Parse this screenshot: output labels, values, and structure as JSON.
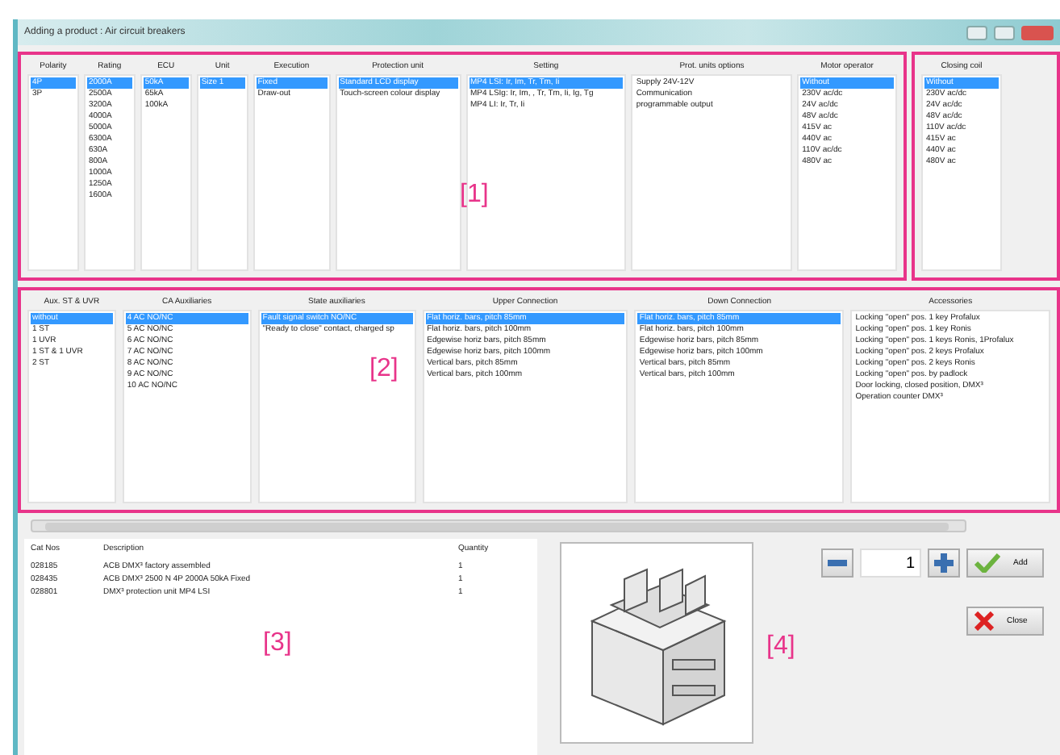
{
  "window": {
    "title": "Adding a product : Air circuit breakers"
  },
  "top_panel": {
    "annotation": "[1]",
    "columns": [
      {
        "heading": "Polarity",
        "items": [
          {
            "label": "4P",
            "selected": true
          },
          {
            "label": "3P",
            "selected": false
          }
        ]
      },
      {
        "heading": "Rating",
        "items": [
          {
            "label": "2000A",
            "selected": true
          },
          {
            "label": "2500A",
            "selected": false
          },
          {
            "label": "3200A",
            "selected": false
          },
          {
            "label": "4000A",
            "selected": false
          },
          {
            "label": "5000A",
            "selected": false
          },
          {
            "label": "6300A",
            "selected": false
          },
          {
            "label": "630A",
            "selected": false
          },
          {
            "label": "800A",
            "selected": false
          },
          {
            "label": "1000A",
            "selected": false
          },
          {
            "label": "1250A",
            "selected": false
          },
          {
            "label": "1600A",
            "selected": false
          }
        ]
      },
      {
        "heading": "ECU",
        "items": [
          {
            "label": "50kA",
            "selected": true
          },
          {
            "label": "65kA",
            "selected": false
          },
          {
            "label": "100kA",
            "selected": false
          }
        ]
      },
      {
        "heading": "Unit",
        "items": [
          {
            "label": "Size 1",
            "selected": true
          }
        ]
      },
      {
        "heading": "Execution",
        "items": [
          {
            "label": "Fixed",
            "selected": true
          },
          {
            "label": "Draw-out",
            "selected": false
          }
        ]
      },
      {
        "heading": "Protection unit",
        "items": [
          {
            "label": "Standard LCD display",
            "selected": true
          },
          {
            "label": "Touch-screen colour display",
            "selected": false
          }
        ]
      },
      {
        "heading": "Setting",
        "items": [
          {
            "label": "MP4 LSI: Ir, Im, Tr, Tm, Ii",
            "selected": true
          },
          {
            "label": "MP4 LSIg: Ir, Im, , Tr, Tm, Ii, Ig, Tg",
            "selected": false
          },
          {
            "label": "MP4 LI: Ir, Tr, Ii",
            "selected": false
          }
        ]
      },
      {
        "heading": "Prot. units options",
        "items": [
          {
            "label": "Supply 24V-12V",
            "selected": false
          },
          {
            "label": "Communication",
            "selected": false
          },
          {
            "label": "programmable output",
            "selected": false
          }
        ]
      },
      {
        "heading": "Motor operator",
        "items": [
          {
            "label": "Without",
            "selected": true
          },
          {
            "label": "230V ac/dc",
            "selected": false
          },
          {
            "label": "24V ac/dc",
            "selected": false
          },
          {
            "label": "48V ac/dc",
            "selected": false
          },
          {
            "label": "415V ac",
            "selected": false
          },
          {
            "label": "440V ac",
            "selected": false
          },
          {
            "label": "110V ac/dc",
            "selected": false
          },
          {
            "label": "480V ac",
            "selected": false
          }
        ]
      }
    ]
  },
  "closing_coil": {
    "heading": "Closing coil",
    "items": [
      {
        "label": "Without",
        "selected": true
      },
      {
        "label": "230V ac/dc",
        "selected": false
      },
      {
        "label": "24V ac/dc",
        "selected": false
      },
      {
        "label": "48V ac/dc",
        "selected": false
      },
      {
        "label": "110V ac/dc",
        "selected": false
      },
      {
        "label": "415V ac",
        "selected": false
      },
      {
        "label": "440V ac",
        "selected": false
      },
      {
        "label": "480V ac",
        "selected": false
      }
    ]
  },
  "options_panel": {
    "annotation": "[2]",
    "columns": [
      {
        "heading": "Aux. ST & UVR",
        "items": [
          {
            "label": "without",
            "selected": true
          },
          {
            "label": "1 ST",
            "selected": false
          },
          {
            "label": "1 UVR",
            "selected": false
          },
          {
            "label": "1 ST & 1 UVR",
            "selected": false
          },
          {
            "label": "2 ST",
            "selected": false
          }
        ]
      },
      {
        "heading": "CA Auxiliaries",
        "items": [
          {
            "label": "4 AC NO/NC",
            "selected": true
          },
          {
            "label": "5 AC NO/NC",
            "selected": false
          },
          {
            "label": "6 AC NO/NC",
            "selected": false
          },
          {
            "label": "7 AC NO/NC",
            "selected": false
          },
          {
            "label": "8 AC NO/NC",
            "selected": false
          },
          {
            "label": "9 AC NO/NC",
            "selected": false
          },
          {
            "label": "10 AC NO/NC",
            "selected": false
          }
        ]
      },
      {
        "heading": "State auxiliaries",
        "items": [
          {
            "label": "Fault signal switch NO/NC",
            "selected": true
          },
          {
            "label": "\"Ready to close\" contact, charged sp",
            "selected": false
          }
        ]
      },
      {
        "heading": "Upper Connection",
        "items": [
          {
            "label": "Flat horiz. bars, pitch 85mm",
            "selected": true
          },
          {
            "label": "Flat horiz. bars, pitch 100mm",
            "selected": false
          },
          {
            "label": "Edgewise horiz bars, pitch 85mm",
            "selected": false
          },
          {
            "label": "Edgewise horiz bars, pitch 100mm",
            "selected": false
          },
          {
            "label": "Vertical bars, pitch 85mm",
            "selected": false
          },
          {
            "label": "Vertical bars, pitch 100mm",
            "selected": false
          }
        ]
      },
      {
        "heading": "Down Connection",
        "items": [
          {
            "label": "Flat horiz. bars, pitch 85mm",
            "selected": true
          },
          {
            "label": "Flat horiz. bars, pitch 100mm",
            "selected": false
          },
          {
            "label": "Edgewise horiz bars, pitch 85mm",
            "selected": false
          },
          {
            "label": "Edgewise horiz bars, pitch 100mm",
            "selected": false
          },
          {
            "label": "Vertical bars, pitch 85mm",
            "selected": false
          },
          {
            "label": "Vertical bars, pitch 100mm",
            "selected": false
          }
        ]
      },
      {
        "heading": "Accessories",
        "items": [
          {
            "label": "Locking \"open\" pos. 1 key Profalux",
            "selected": false
          },
          {
            "label": "Locking \"open\" pos. 1 key Ronis",
            "selected": false
          },
          {
            "label": "Locking \"open\" pos. 1 keys Ronis, 1Profalux",
            "selected": false
          },
          {
            "label": "Locking \"open\" pos. 2 keys Profalux",
            "selected": false
          },
          {
            "label": "Locking \"open\" pos. 2 keys Ronis",
            "selected": false
          },
          {
            "label": "Locking \"open\" pos. by padlock",
            "selected": false
          },
          {
            "label": "Door locking, closed position, DMX³",
            "selected": false
          },
          {
            "label": "Operation counter DMX³",
            "selected": false
          }
        ]
      }
    ]
  },
  "table": {
    "annotation": "[3]",
    "columns": [
      "Cat Nos",
      "Description",
      "Quantity"
    ],
    "rows": [
      [
        "028185",
        "ACB DMX³ factory assembled",
        "1"
      ],
      [
        "028435",
        "ACB DMX³ 2500 N 4P 2000A 50kA Fixed",
        "1"
      ],
      [
        "028801",
        "DMX³ protection unit MP4 LSI",
        "1"
      ]
    ]
  },
  "preview": {
    "annotation": "[4]"
  },
  "quantity": {
    "value": "1"
  },
  "buttons": [
    {
      "label": "Add",
      "kind": "add"
    },
    {
      "label": "Close",
      "kind": "close"
    }
  ]
}
